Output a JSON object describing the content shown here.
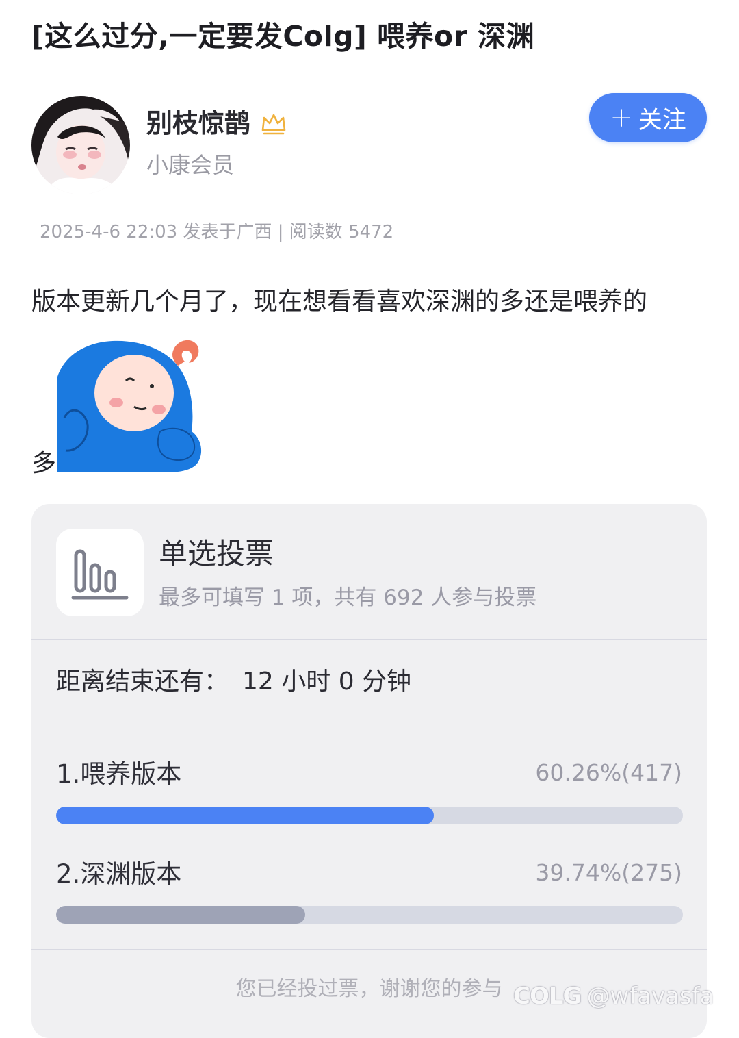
{
  "post": {
    "title": "[这么过分,一定要发Colg] 喂养or 深渊",
    "author": {
      "name": "别枝惊鹊",
      "level": "小康会员"
    },
    "follow_label": "关注",
    "meta": "2025-4-6 22:03 发表于广西 | 阅读数 5472",
    "body": "版本更新几个月了，现在想看看喜欢深渊的多还是喂养的",
    "body_tail": "多"
  },
  "poll": {
    "type": "单选投票",
    "description": "最多可填写 1 项，共有 692 人参与投票",
    "countdown_label": "距离结束还有：",
    "countdown_value": "12 小时 0 分钟",
    "options": [
      {
        "label": "1.喂养版本",
        "result": "60.26%(417)",
        "percent": 60.26,
        "color": "#4b82f4"
      },
      {
        "label": "2.深渊版本",
        "result": "39.74%(275)",
        "percent": 39.74,
        "color": "#9ea3b6"
      }
    ],
    "footer": "您已经投过票，谢谢您的参与"
  },
  "watermark": {
    "logo": "COLG",
    "handle": "@wfavasfa"
  },
  "icons": {
    "crown": "crown-icon",
    "poll": "bar-chart-icon",
    "plus": "plus-icon"
  },
  "colors": {
    "accent": "#4b82f4",
    "secondary_bar": "#9ea3b6",
    "card_bg": "#f0f0f2"
  }
}
